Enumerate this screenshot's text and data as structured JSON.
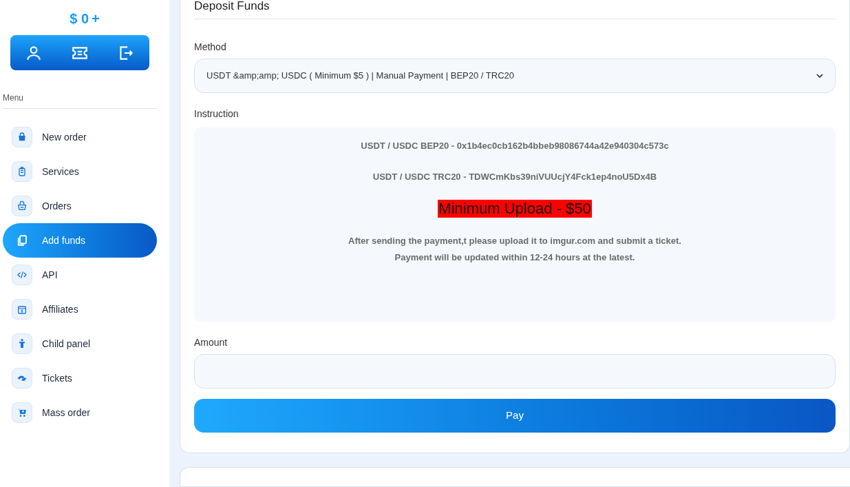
{
  "balance": {
    "amount": "$ 0",
    "add": "+"
  },
  "menu": {
    "heading": "Menu",
    "items": [
      {
        "label": "New order",
        "selected": false
      },
      {
        "label": "Services",
        "selected": false
      },
      {
        "label": "Orders",
        "selected": false
      },
      {
        "label": "Add funds",
        "selected": true
      },
      {
        "label": "API",
        "selected": false
      },
      {
        "label": "Affiliates",
        "selected": false
      },
      {
        "label": "Child panel",
        "selected": false
      },
      {
        "label": "Tickets",
        "selected": false
      },
      {
        "label": "Mass order",
        "selected": false
      }
    ]
  },
  "deposit": {
    "title": "Deposit Funds",
    "method_label": "Method",
    "method_value": "USDT &amp;amp; USDC ( Minimum $5 ) | Manual Payment | BEP20 / TRC20",
    "instruction_label": "Instruction",
    "instruction": [
      {
        "kind": "address",
        "text": "USDT / USDC BEP20 - 0x1b4ec0cb162b4bbeb98086744a42e940304c573c"
      },
      {
        "kind": "address",
        "text": "USDT / USDC TRC20 - TDWCmKbs39niVUUcjY4Fck1ep4noU5Dx4B"
      },
      {
        "kind": "highlight",
        "text": "Minimum Upload - $50"
      },
      {
        "kind": "note",
        "text": "After sending the payment,t please upload it to imgur.com and submit a ticket."
      },
      {
        "kind": "note",
        "text": "Payment will be updated within 12-24 hours at the latest."
      }
    ],
    "amount_label": "Amount",
    "button": "Pay"
  }
}
